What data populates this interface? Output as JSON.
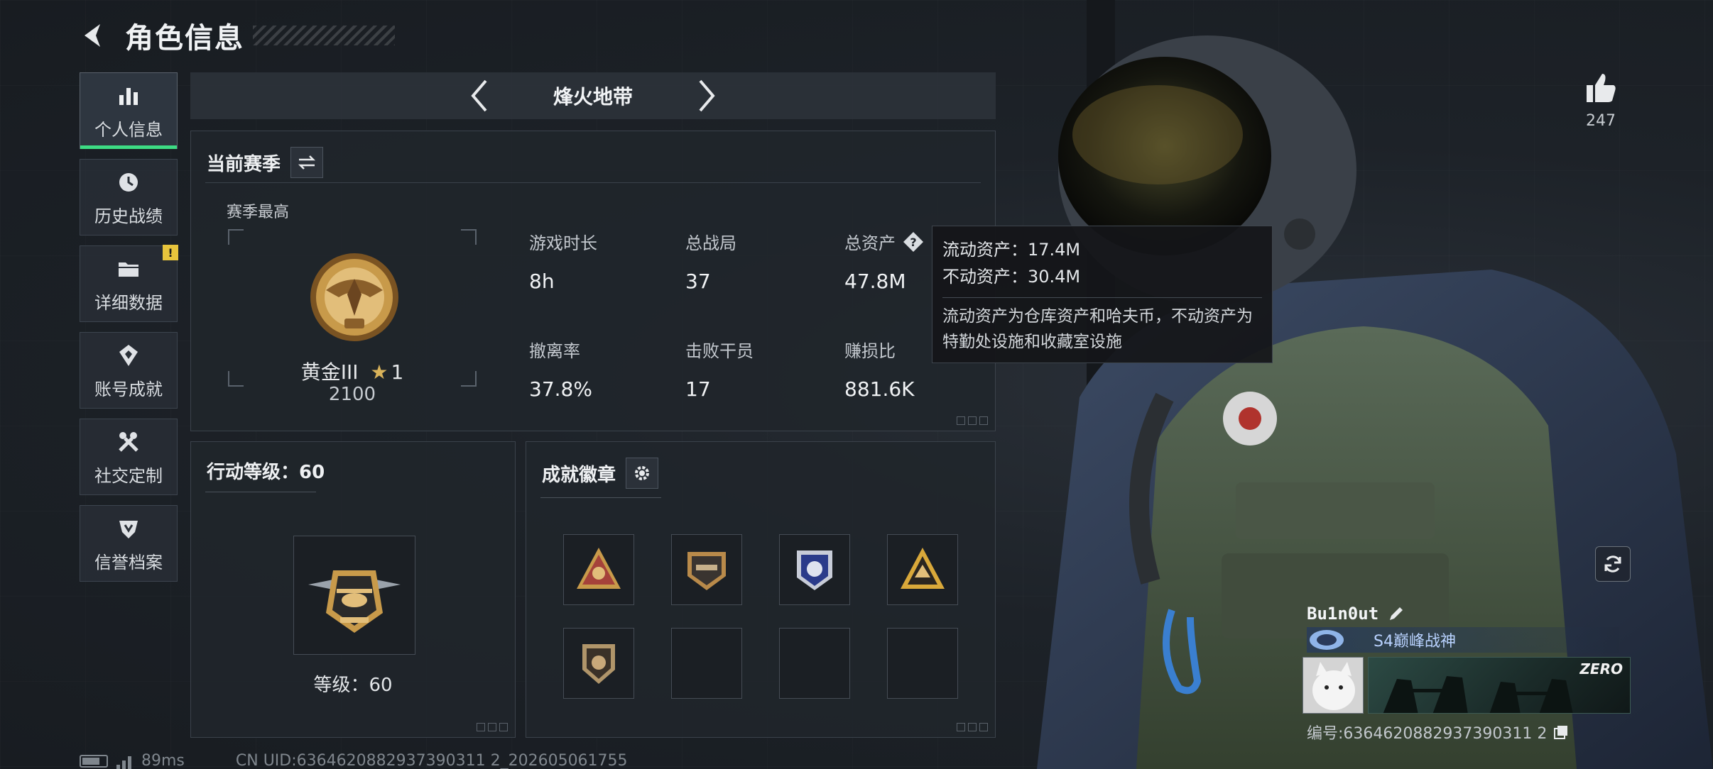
{
  "header": {
    "title": "角色信息"
  },
  "sidenav": {
    "items": [
      {
        "label": "个人信息",
        "icon": "bar-chart-icon",
        "active": true
      },
      {
        "label": "历史战绩",
        "icon": "history-clock-icon"
      },
      {
        "label": "详细数据",
        "icon": "folder-icon",
        "alert": "!"
      },
      {
        "label": "账号成就",
        "icon": "achievement-badge-icon"
      },
      {
        "label": "社交定制",
        "icon": "tools-icon"
      },
      {
        "label": "信誉档案",
        "icon": "credit-shield-icon"
      }
    ]
  },
  "mode": {
    "title": "烽火地带"
  },
  "season": {
    "title": "当前赛季",
    "best_label": "赛季最高",
    "rank_name": "黄金III",
    "rank_stars": "1",
    "rank_score": "2100",
    "stats": [
      {
        "label": "游戏时长",
        "value": "8h"
      },
      {
        "label": "总战局",
        "value": "37"
      },
      {
        "label": "总资产",
        "value": "47.8M"
      },
      {
        "label": "撤离率",
        "value": "37.8%"
      },
      {
        "label": "击败干员",
        "value": "17"
      },
      {
        "label": "赚损比",
        "value": "881.6K"
      }
    ]
  },
  "tooltip": {
    "liquid": "流动资产：17.4M",
    "fixed": "不动资产：30.4M",
    "desc": "流动资产为仓库资产和哈夫币，不动资产为特勤处设施和收藏室设施"
  },
  "level": {
    "title": "行动等级：60",
    "text": "等级：60"
  },
  "achievements": {
    "title": "成就徽章",
    "badges": [
      "red-triangle-badge",
      "helicopter-shield-badge",
      "blue-shield-badge",
      "gold-triangle-badge",
      "lion-shield-badge",
      "empty",
      "empty",
      "empty"
    ]
  },
  "profile": {
    "likes": "247",
    "name": "Bu1n0ut",
    "title": "S4巅峰战神",
    "banner_text": "ZERO",
    "id_text": "编号:6364620882937390311 2"
  },
  "footer": {
    "ping": "89ms",
    "uid": "CN UID:6364620882937390311 2_202605061755"
  },
  "colors": {
    "accent": "#3ddc84",
    "alert": "#e7c43c",
    "gold": "#c89a4a"
  }
}
